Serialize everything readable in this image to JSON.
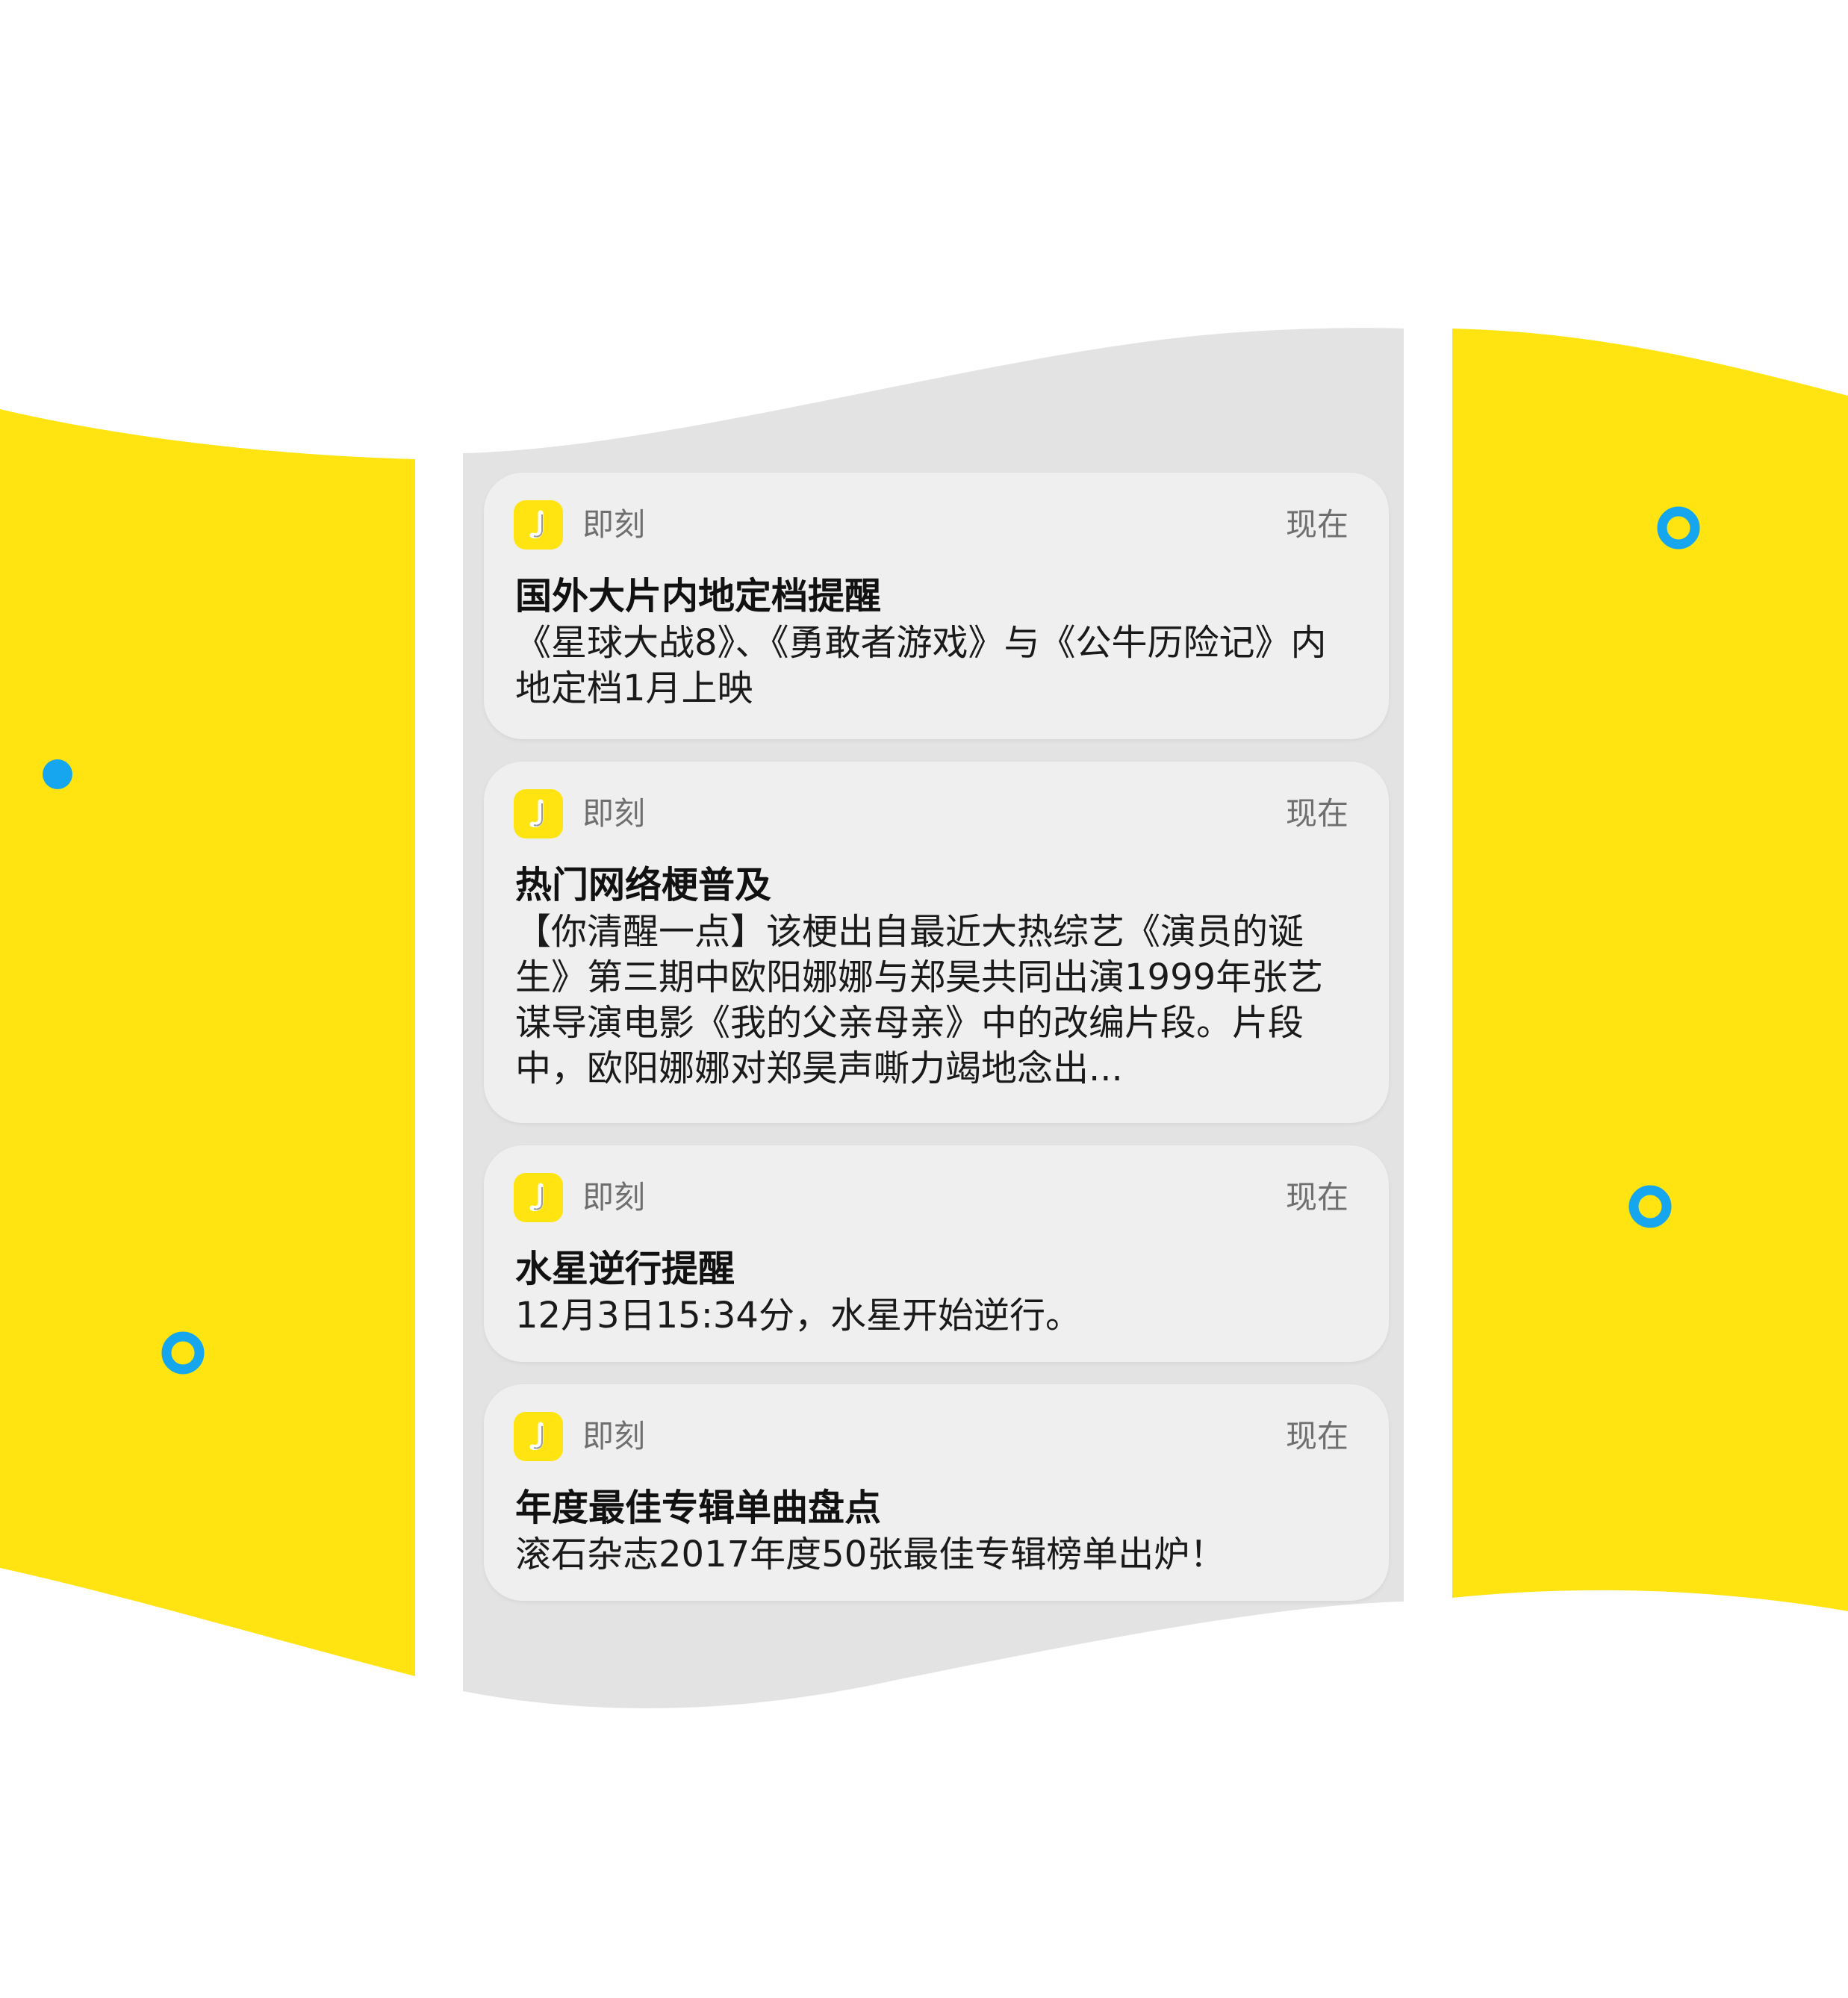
{
  "colors": {
    "brand_yellow": "#FFE411",
    "accent_blue": "#16A6EF",
    "panel_gray": "#E3E3E3",
    "card_bg": "#EFEFEF"
  },
  "notifications": [
    {
      "icon": "jike-app-icon",
      "app_name": "即刻",
      "time": "现在",
      "title": "国外大片内地定档提醒",
      "body": "《星球大战8》、《勇敢者游戏》与《公牛历险记》内地定档1月上映"
    },
    {
      "icon": "jike-app-icon",
      "app_name": "即刻",
      "time": "现在",
      "title": "热门网络梗普及",
      "body": "【你清醒一点】该梗出自最近大热综艺《演员的诞生》第三期中欧阳娜娜与郑昊共同出演1999年张艺谋导演电影《我的父亲母亲》中的改编片段。片段中，欧阳娜娜对郑昊声嘶力竭地念出..."
    },
    {
      "icon": "jike-app-icon",
      "app_name": "即刻",
      "time": "现在",
      "title": "水星逆行提醒",
      "body": "12月3日15:34分，水星开始逆行。"
    },
    {
      "icon": "jike-app-icon",
      "app_name": "即刻",
      "time": "现在",
      "title": "年度最佳专辑单曲盘点",
      "body": "滚石杂志2017年度50张最佳专辑榜单出炉！"
    }
  ]
}
